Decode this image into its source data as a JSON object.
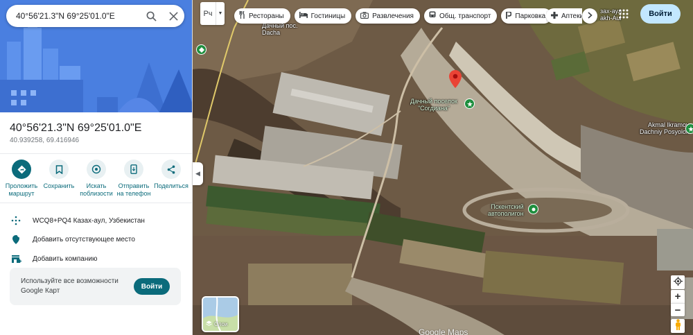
{
  "search": {
    "value": "40°56'21.3\"N 69°25'01.0\"E"
  },
  "place": {
    "title": "40°56'21.3\"N 69°25'01.0\"E",
    "coords": "40.939258, 69.416946"
  },
  "actions": [
    {
      "label": "Проложить маршрут",
      "icon": "directions-icon"
    },
    {
      "label": "Сохранить",
      "icon": "bookmark-icon"
    },
    {
      "label": "Искать поблизости",
      "icon": "nearby-icon"
    },
    {
      "label": "Отправить на телефон",
      "icon": "send-to-phone-icon"
    },
    {
      "label": "Поделиться",
      "icon": "share-icon"
    }
  ],
  "info_rows": [
    {
      "text": "WCQ8+PQ4 Казах-аул, Узбекистан",
      "icon": "plus-code-icon"
    },
    {
      "text": "Добавить отсутствующее место",
      "icon": "add-place-icon"
    },
    {
      "text": "Добавить компанию",
      "icon": "add-business-icon"
    }
  ],
  "promo": {
    "text": "Используйте все возможности Google Карт",
    "button": "Войти"
  },
  "layer_toggle": {
    "label": "Рч"
  },
  "chips": [
    {
      "label": "Рестораны",
      "icon": "restaurant-icon"
    },
    {
      "label": "Гостиницы",
      "icon": "hotel-icon"
    },
    {
      "label": "Развлечения",
      "icon": "camera-icon"
    },
    {
      "label": "Общ. транспорт",
      "icon": "transit-icon"
    },
    {
      "label": "Парковка",
      "icon": "parking-icon"
    },
    {
      "label": "Аптеки",
      "icon": "pharmacy-icon"
    }
  ],
  "header": {
    "signin": "Войти"
  },
  "map_labels": {
    "dacha": "Дачный пос.\nDacha",
    "kazakh_aul": "зах-аул\nakh-Aul",
    "sogdiana": "Дачный поселок\n\"Согдиана\"",
    "akmal": "Akmal Ikramov\nDachniy Posyolok",
    "autopolygon": "Пскентский\nавтополигон"
  },
  "layers": {
    "label": "Слои"
  },
  "watermark": "Google Maps",
  "colors": {
    "accent": "#0b6b7b",
    "signin_bg": "#c2e7ff",
    "pin": "#ea4335",
    "poi": "#1e8e3e"
  }
}
